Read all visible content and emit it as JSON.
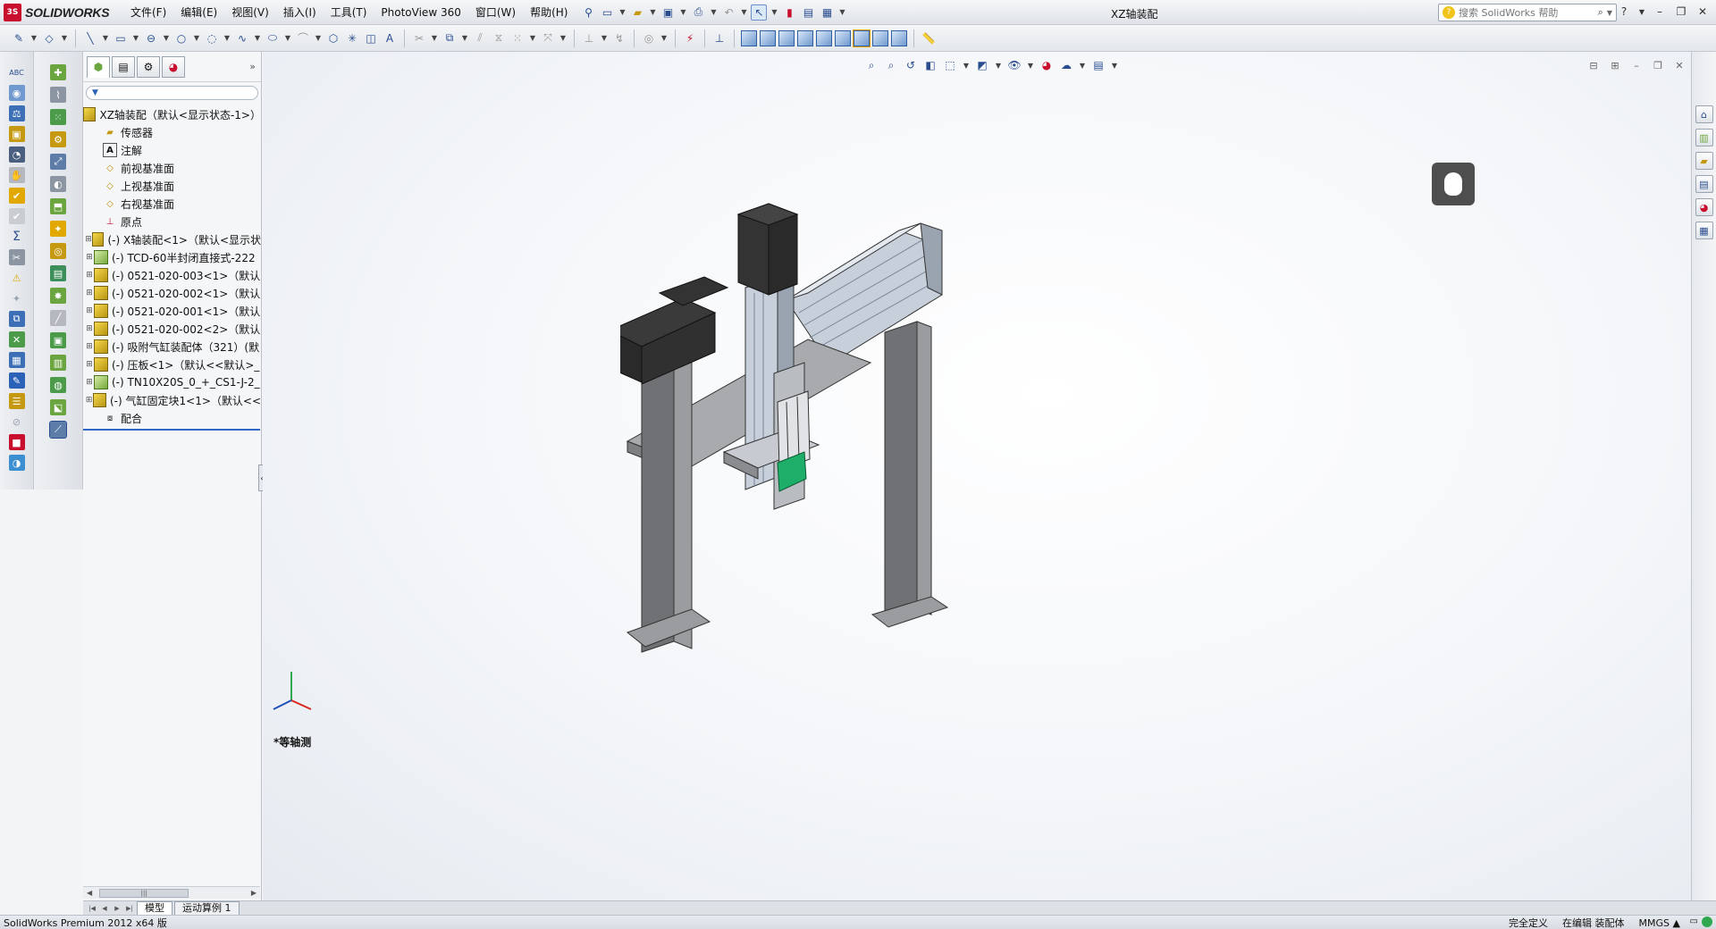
{
  "app": {
    "brand": "SOLIDWORKS",
    "document_title": "XZ轴装配",
    "menu": [
      "文件(F)",
      "编辑(E)",
      "视图(V)",
      "插入(I)",
      "工具(T)",
      "PhotoView 360",
      "窗口(W)",
      "帮助(H)"
    ],
    "help_search_placeholder": "搜索 SolidWorks 帮助"
  },
  "feature_tree": {
    "root": "XZ轴装配（默认<显示状态-1>）",
    "items": [
      {
        "label": "传感器",
        "icon": "sensor-folder-icon"
      },
      {
        "label": "注解",
        "icon": "annotation-icon"
      },
      {
        "label": "前视基准面",
        "icon": "plane-icon"
      },
      {
        "label": "上视基准面",
        "icon": "plane-icon"
      },
      {
        "label": "右视基准面",
        "icon": "plane-icon"
      },
      {
        "label": "原点",
        "icon": "origin-icon"
      },
      {
        "label": "(-) X轴装配<1>（默认<显示状",
        "icon": "assembly-icon"
      },
      {
        "label": "(-) TCD-60半封闭直接式-222",
        "icon": "part-icon"
      },
      {
        "label": "(-) 0521-020-003<1>（默认",
        "icon": "assembly-icon"
      },
      {
        "label": "(-) 0521-020-002<1>（默认",
        "icon": "assembly-icon"
      },
      {
        "label": "(-) 0521-020-001<1>（默认",
        "icon": "assembly-icon"
      },
      {
        "label": "(-) 0521-020-002<2>（默认",
        "icon": "assembly-icon"
      },
      {
        "label": "(-) 吸附气缸装配体（321）(默",
        "icon": "assembly-icon"
      },
      {
        "label": "(-) 压板<1>（默认<<默认>_",
        "icon": "assembly-icon"
      },
      {
        "label": "(-) TN10X20S_0_+_CS1-J-2_",
        "icon": "part-icon"
      },
      {
        "label": "(-) 气缸固定块1<1>（默认<<",
        "icon": "assembly-icon"
      },
      {
        "label": "配合",
        "icon": "mates-icon"
      }
    ]
  },
  "viewport": {
    "view_label": "*等轴测"
  },
  "bottom_tabs": [
    "模型",
    "运动算例 1"
  ],
  "status": {
    "app_version": "SolidWorks Premium 2012 x64 版",
    "definition": "完全定义",
    "editing": "在编辑 装配体",
    "units": "MMGS"
  },
  "colors": {
    "accent": "#2f6bc4",
    "model_dark": "#2e2e2e",
    "model_frame": "#8a8c90",
    "model_rail": "#b9c2cf",
    "gripper_green": "#1fae6a"
  }
}
